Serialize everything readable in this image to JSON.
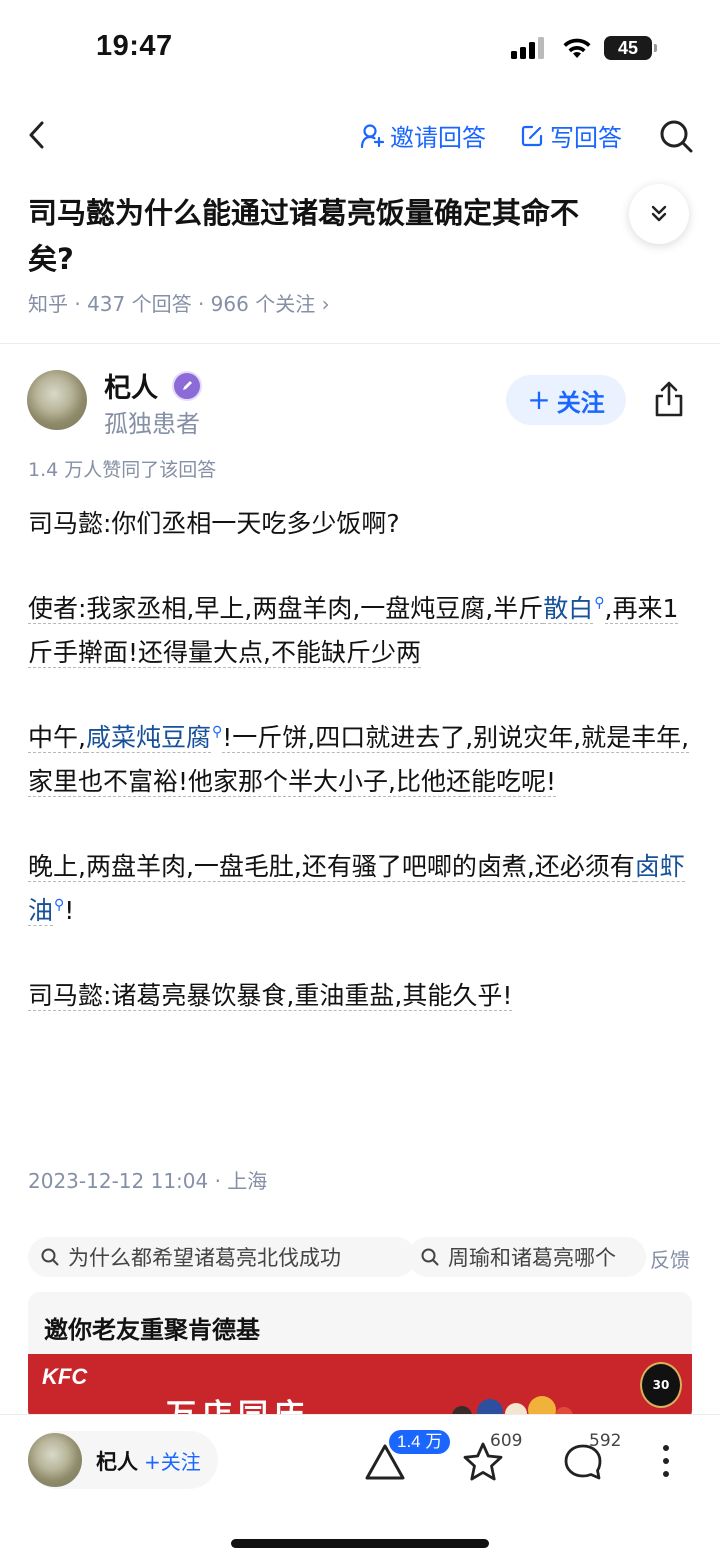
{
  "status_bar": {
    "time": "19:47",
    "battery": "45"
  },
  "nav": {
    "invite_label": "邀请回答",
    "write_label": "写回答"
  },
  "question": {
    "title_line1": "司马懿为什么能通过诸葛亮饭量确定其命不",
    "title_line2": "矣?",
    "meta": "知乎 · 437 个回答 · 966 个关注 ›"
  },
  "author": {
    "name": "杞人",
    "bio": "孤独患者",
    "follow_label": "关注",
    "upvote_line": "1.4 万人赞同了该回答"
  },
  "answer": {
    "p1": "司马懿:你们丞相一天吃多少饭啊?",
    "p2_a": "使者:我家丞相,早上,两盘羊肉,一盘炖豆腐,半斤",
    "p2_kw": "散白",
    "p2_b": ",再来1斤手擀面!还得量大点,不能缺斤少两",
    "p3_a": "中午,",
    "p3_kw": "咸菜炖豆腐",
    "p3_b": "!一斤饼,四口就进去了,别说灾年,就是丰年,家里也不富裕!他家那个半大小子,比他还能吃呢!",
    "p4_a": "晚上,两盘羊肉,一盘毛肚,还有骚了吧唧的卤煮,还必须有",
    "p4_kw": "卤虾油",
    "p4_b": "!",
    "p5": "司马懿:诸葛亮暴饮暴食,重油重盐,其能久乎!",
    "date": "2023-12-12 11:04 · 上海"
  },
  "related": {
    "tag1": "为什么都希望诸葛亮北伐成功",
    "tag2": "周瑜和诸葛亮哪个",
    "feedback": "反馈"
  },
  "ad": {
    "title": "邀你老友重聚肯德基",
    "brand": "KFC",
    "slogan": "万店同庆",
    "anniv": "30"
  },
  "bottom_bar": {
    "name": "杞人",
    "follow": "+关注",
    "upvotes": "1.4 万",
    "favorites": "609",
    "comments": "592"
  },
  "colors": {
    "accent": "#1a66ff",
    "keyword": "#175199",
    "meta_gray": "#8590a6",
    "ad_red": "#c8262b"
  }
}
